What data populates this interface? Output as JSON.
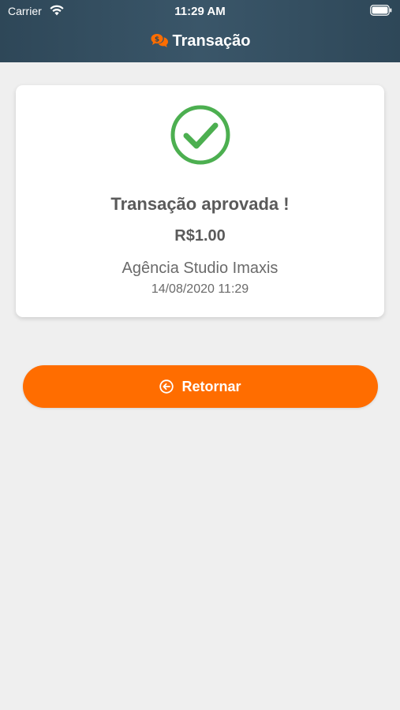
{
  "status_bar": {
    "carrier": "Carrier",
    "time": "11:29 AM"
  },
  "nav": {
    "title": "Transação",
    "icon": "chat-bubbles-icon"
  },
  "card": {
    "title": "Transação aprovada !",
    "amount": "R$1.00",
    "merchant": "Agência Studio Imaxis",
    "datetime": "14/08/2020 11:29",
    "status_icon": "check-circle-icon"
  },
  "actions": {
    "return_label": "Retornar",
    "return_icon": "arrow-left-circle-icon"
  },
  "colors": {
    "header_bg": "#2e4758",
    "accent": "#ff6d00",
    "success": "#4caf50",
    "background": "#efefef",
    "text": "#5a5a5a"
  }
}
